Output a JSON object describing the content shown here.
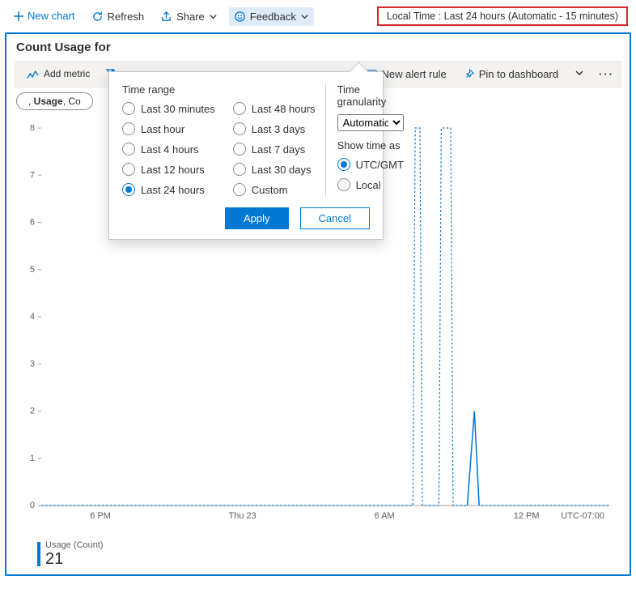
{
  "toolbar": {
    "new_chart": "New chart",
    "refresh": "Refresh",
    "share": "Share",
    "feedback": "Feedback",
    "local_time": "Local Time : Last 24 hours (Automatic - 15 minutes)"
  },
  "panel": {
    "title": "Count Usage for",
    "add_metric": "Add metric",
    "new_alert_rule": "New alert rule",
    "pin_to_dashboard": "Pin to dashboard",
    "chip": ", Usage, Co"
  },
  "popover": {
    "time_range_label": "Time range",
    "options_col1": [
      "Last 30 minutes",
      "Last hour",
      "Last 4 hours",
      "Last 12 hours",
      "Last 24 hours"
    ],
    "options_col2": [
      "Last 48 hours",
      "Last 3 days",
      "Last 7 days",
      "Last 30 days",
      "Custom"
    ],
    "selected_range": "Last 24 hours",
    "granularity_label": "Time granularity",
    "granularity_value": "Automatic",
    "show_time_label": "Show time as",
    "show_time_options": [
      "UTC/GMT",
      "Local"
    ],
    "show_time_selected": "UTC/GMT",
    "apply": "Apply",
    "cancel": "Cancel"
  },
  "chart_data": {
    "type": "line",
    "title": "Count Usage",
    "xlabel": "",
    "ylabel": "",
    "ylim": [
      0,
      8
    ],
    "yticks": [
      0,
      1,
      2,
      3,
      4,
      5,
      6,
      7,
      8
    ],
    "x_ticks": [
      "6 PM",
      "Thu 23",
      "6 AM",
      "12 PM"
    ],
    "x_range_hours": 24,
    "tz_label": "UTC-07:00",
    "series": [
      {
        "name": "Usage (Count)",
        "style": "dashed",
        "x_hours": [
          0,
          15.7,
          15.8,
          16.0,
          16.1,
          16.8,
          16.9,
          17.3,
          17.4,
          18.0,
          18.3,
          18.4,
          18.5,
          24
        ],
        "values": [
          0,
          0,
          8,
          8,
          0,
          0,
          8,
          8,
          0,
          0,
          2,
          1,
          0,
          0
        ]
      },
      {
        "name": "Usage (Count) solid",
        "style": "solid",
        "x_hours": [
          18.0,
          18.3,
          18.4,
          18.5
        ],
        "values": [
          0,
          2,
          1,
          0
        ]
      }
    ],
    "legend": {
      "label": "Usage (Count)",
      "value": "21"
    }
  }
}
